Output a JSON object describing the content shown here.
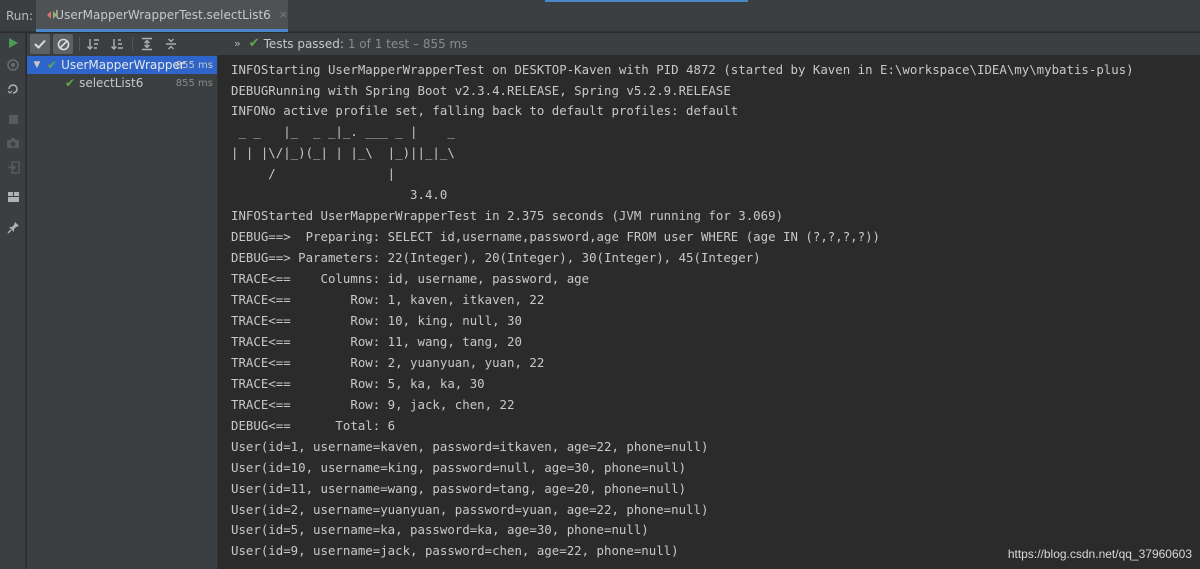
{
  "run_bar": {
    "label": "Run:",
    "tab_title": "UserMapperWrapperTest.selectList6",
    "close_glyph": "×"
  },
  "toolbar": {
    "chevron": "»",
    "status_passed": "Tests passed:",
    "status_detail": "1 of 1 test – 855 ms"
  },
  "tree": {
    "items": [
      {
        "name": "UserMapperWrapper",
        "time": "855 ms",
        "expanded": true,
        "selected": true
      },
      {
        "name": "selectList6",
        "time": "855 ms"
      }
    ]
  },
  "console": {
    "lines": [
      "INFOStarting UserMapperWrapperTest on DESKTOP-Kaven with PID 4872 (started by Kaven in E:\\workspace\\IDEA\\my\\mybatis-plus)",
      "DEBUGRunning with Spring Boot v2.3.4.RELEASE, Spring v5.2.9.RELEASE",
      "INFONo active profile set, falling back to default profiles: default",
      " _ _   |_  _ _|_. ___ _ |    _",
      "| | |\\/|_)(_| | |_\\  |_)||_|_\\",
      "     /               |",
      "                        3.4.0",
      "INFOStarted UserMapperWrapperTest in 2.375 seconds (JVM running for 3.069)",
      "DEBUG==>  Preparing: SELECT id,username,password,age FROM user WHERE (age IN (?,?,?,?))",
      "DEBUG==> Parameters: 22(Integer), 20(Integer), 30(Integer), 45(Integer)",
      "TRACE<==    Columns: id, username, password, age",
      "TRACE<==        Row: 1, kaven, itkaven, 22",
      "TRACE<==        Row: 10, king, null, 30",
      "TRACE<==        Row: 11, wang, tang, 20",
      "TRACE<==        Row: 2, yuanyuan, yuan, 22",
      "TRACE<==        Row: 5, ka, ka, 30",
      "TRACE<==        Row: 9, jack, chen, 22",
      "DEBUG<==      Total: 6",
      "User(id=1, username=kaven, password=itkaven, age=22, phone=null)",
      "User(id=10, username=king, password=null, age=30, phone=null)",
      "User(id=11, username=wang, password=tang, age=20, phone=null)",
      "User(id=2, username=yuanyuan, password=yuan, age=22, phone=null)",
      "User(id=5, username=ka, password=ka, age=30, phone=null)",
      "User(id=9, username=jack, password=chen, age=22, phone=null)"
    ]
  },
  "watermark": "https://blog.csdn.net/qq_37960603",
  "colors": {
    "accent": "#2f65ca",
    "success": "#62a64a",
    "panel": "#3c3f41",
    "console_bg": "#2b2b2b"
  }
}
